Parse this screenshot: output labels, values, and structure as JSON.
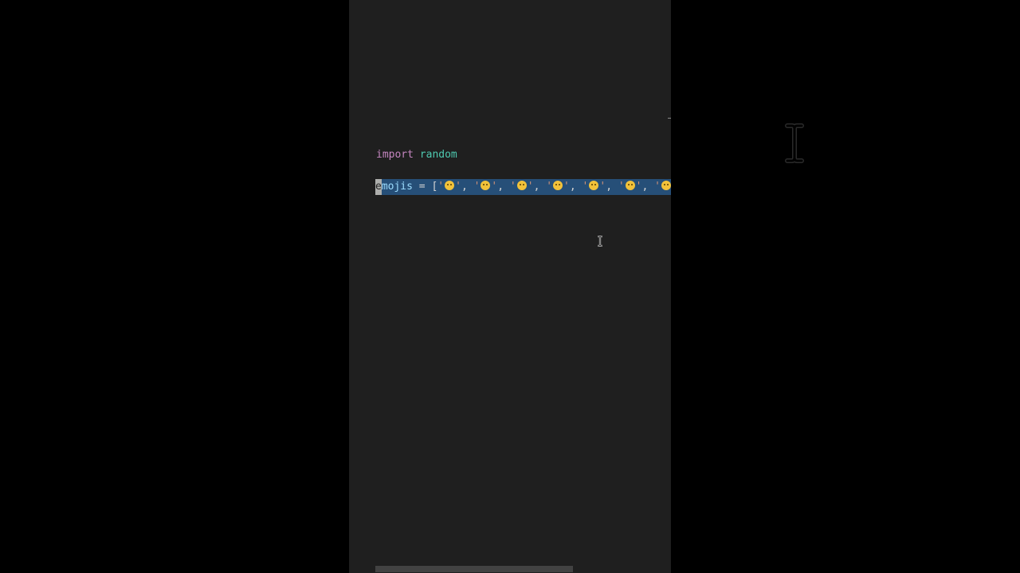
{
  "editor": {
    "lines": [
      {
        "keyword": "import",
        "module": "random"
      },
      {
        "selected_first_char": "e",
        "variable_rest": "mojis",
        "operator": " = ",
        "open_bracket": "[",
        "emoji_count_visible": 7,
        "quote": "'",
        "separator": ", "
      }
    ]
  },
  "colors": {
    "editor_background": "#1f1f1f",
    "outer_background": "#000000",
    "selection": "#264f78",
    "keyword": "#c586c0",
    "module": "#4ec9b0",
    "variable": "#9cdcfe"
  },
  "icons": {
    "mouse_cursor": "text-cursor-icon",
    "large_cursor": "text-cursor-icon"
  }
}
